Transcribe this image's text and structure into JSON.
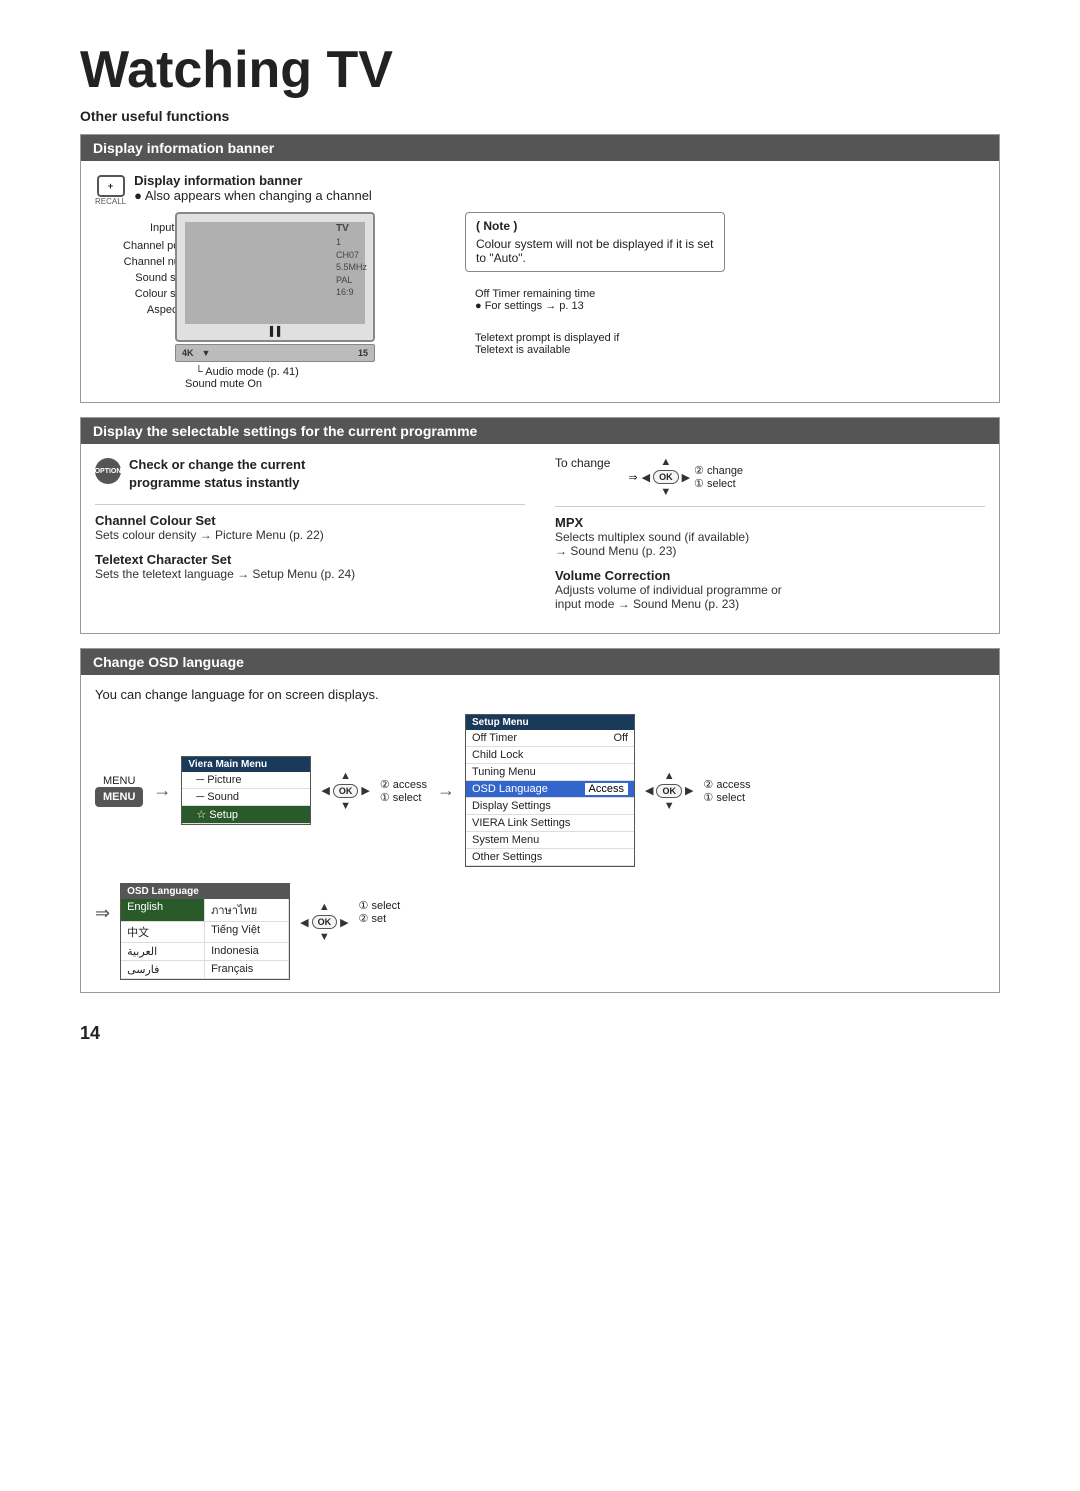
{
  "page": {
    "title": "Watching TV",
    "subtitle": "Other useful functions",
    "page_number": "14"
  },
  "display_banner": {
    "section_title": "Display information banner",
    "recall_label": "RECALL",
    "main_title": "Display information banner",
    "also_appears": "Also appears when changing a channel",
    "labels": [
      {
        "name": "Input mode",
        "value": "TV"
      },
      {
        "name": "Channel position",
        "value": "1"
      },
      {
        "name": "Channel number",
        "value": "CH07"
      },
      {
        "name": "Sound system",
        "value": "5.5MHz"
      },
      {
        "name": "Colour system",
        "value": "PAL"
      },
      {
        "name": "Aspect ratio",
        "value": "16:9"
      }
    ],
    "audio_mode": "Audio mode (p. 41)",
    "sound_mute": "Sound mute On",
    "off_timer": "Off Timer remaining time",
    "for_settings": "For settings → p. 13",
    "teletext_prompt": "Teletext prompt is displayed if",
    "teletext_available": "Teletext is available",
    "note_title": "Note",
    "note_text": "Colour system will not be displayed if it is set to \"Auto\".",
    "bottom_bar_left": "4K",
    "bottom_bar_right": "15"
  },
  "selectable_settings": {
    "section_title": "Display the selectable settings for the current programme",
    "option_label_line1": "Check or change the current",
    "option_label_line2": "programme status instantly",
    "option_icon_text": "OPTION",
    "to_change": "To change",
    "change_label": "② change",
    "select_label": "① select",
    "items": [
      {
        "title": "Channel Colour Set",
        "desc": "Sets colour density → Picture Menu (p. 22)"
      },
      {
        "title": "Teletext Character Set",
        "desc": "Sets the teletext language → Setup Menu (p. 24)"
      },
      {
        "title": "MPX",
        "desc": "Selects multiplex sound (if available)\n→ Sound Menu (p. 23)"
      },
      {
        "title": "Volume Correction",
        "desc": "Adjusts volume of individual programme or\ninput mode → Sound Menu (p. 23)"
      }
    ]
  },
  "change_osd": {
    "section_title": "Change OSD language",
    "desc": "You can change language for on screen displays.",
    "menu_btn": "MENU",
    "arrow_label": "→",
    "main_menu_title": "Viera Main Menu",
    "main_menu_items": [
      "Picture",
      "Sound",
      "Setup"
    ],
    "main_menu_active": "Setup",
    "step1_access": "② access",
    "step1_select": "① select",
    "setup_menu_title": "Setup Menu",
    "setup_menu_items": [
      {
        "label": "Off Timer",
        "value": "Off"
      },
      {
        "label": "Child Lock",
        "value": ""
      },
      {
        "label": "Tuning Menu",
        "value": ""
      },
      {
        "label": "OSD Language",
        "value": "Access"
      },
      {
        "label": "Display Settings",
        "value": ""
      },
      {
        "label": "VIERA Link Settings",
        "value": ""
      },
      {
        "label": "System Menu",
        "value": ""
      },
      {
        "label": "Other Settings",
        "value": ""
      }
    ],
    "step2_access": "② access",
    "step2_select": "① select",
    "osd_lang_title": "OSD Language",
    "languages": [
      {
        "label": "English",
        "selected": true
      },
      {
        "label": "ภาษาไทย",
        "selected": false
      },
      {
        "label": "中文",
        "selected": false
      },
      {
        "label": "Tiếng Việt",
        "selected": false
      },
      {
        "label": "العربية",
        "selected": false
      },
      {
        "label": "Indonesia",
        "selected": false
      },
      {
        "label": "فارسی",
        "selected": false
      },
      {
        "label": "Français",
        "selected": false
      }
    ],
    "step3_select": "① select",
    "step3_set": "② set"
  }
}
